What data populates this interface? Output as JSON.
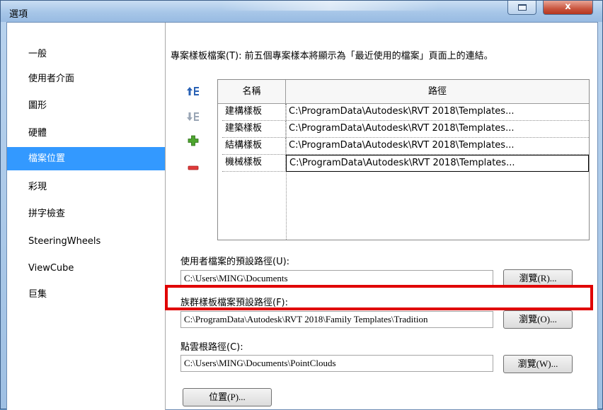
{
  "window": {
    "title": "選項",
    "close_label": "x"
  },
  "sidebar": {
    "items": [
      {
        "label": "一般"
      },
      {
        "label": "使用者介面"
      },
      {
        "label": "圖形"
      },
      {
        "label": "硬體"
      },
      {
        "label": "檔案位置"
      },
      {
        "label": "彩現"
      },
      {
        "label": "拼字檢查"
      },
      {
        "label": "SteeringWheels"
      },
      {
        "label": "ViewCube"
      },
      {
        "label": "巨集"
      }
    ],
    "selected": "檔案位置"
  },
  "project_templates": {
    "description": "專案樣板檔案(T): 前五個專案樣本將顯示為「最近使用的檔案」頁面上的連結。",
    "columns": [
      "名稱",
      "路徑"
    ],
    "rows": [
      {
        "name": "建構樣板",
        "path": "C:\\ProgramData\\Autodesk\\RVT 2018\\Templates..."
      },
      {
        "name": "建築樣板",
        "path": "C:\\ProgramData\\Autodesk\\RVT 2018\\Templates..."
      },
      {
        "name": "結構樣板",
        "path": "C:\\ProgramData\\Autodesk\\RVT 2018\\Templates..."
      },
      {
        "name": "機械樣板",
        "path": "C:\\ProgramData\\Autodesk\\RVT 2018\\Templates..."
      }
    ],
    "icons": [
      "move-up-icon",
      "move-down-icon",
      "add-icon",
      "remove-icon"
    ]
  },
  "user_files": {
    "label": "使用者檔案的預設路徑(U):",
    "value": "C:\\Users\\MING\\Documents",
    "browse_label": "瀏覽(R)..."
  },
  "family_templates": {
    "label": "族群樣板檔案預設路徑(F):",
    "value": "C:\\ProgramData\\Autodesk\\RVT 2018\\Family Templates\\Tradition",
    "browse_label": "瀏覽(O)..."
  },
  "point_cloud": {
    "label": "點雲根路徑(C):",
    "value": "C:\\Users\\MING\\Documents\\PointClouds",
    "browse_label": "瀏覽(W)..."
  },
  "places_button": {
    "label": "位置(P)..."
  },
  "colors": {
    "selection": "#3399ff",
    "highlight": "#e00000"
  }
}
